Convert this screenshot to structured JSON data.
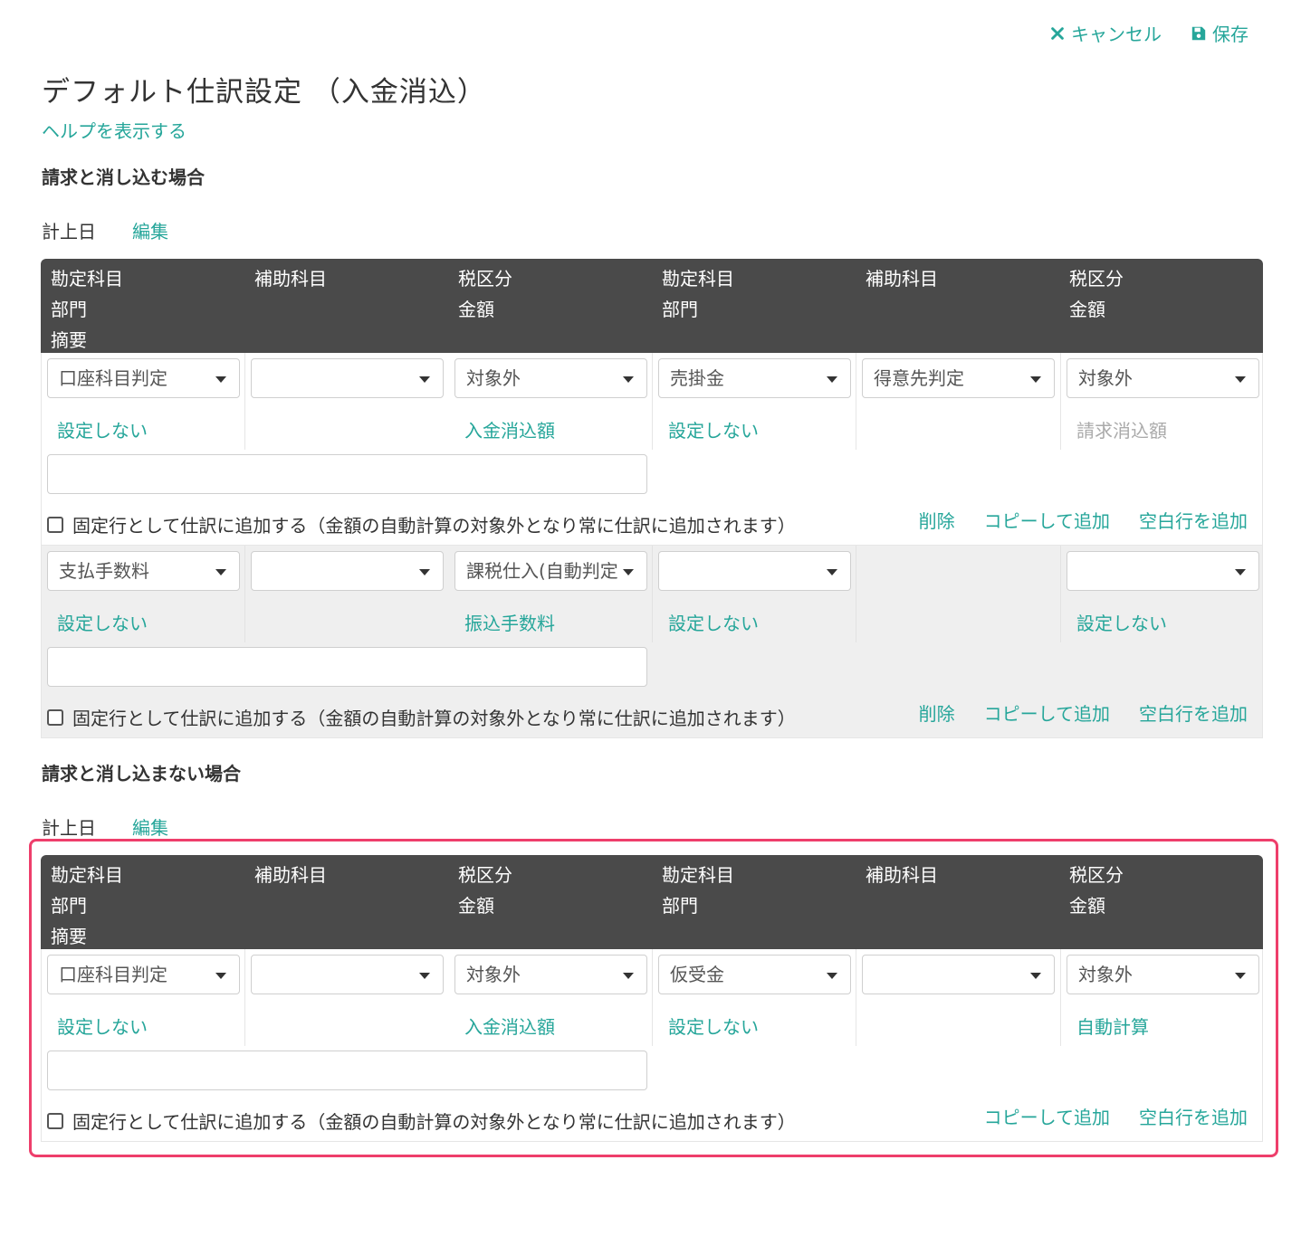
{
  "header": {
    "cancel_label": "キャンセル",
    "save_label": "保存",
    "title": "デフォルト仕訳設定 （入金消込）",
    "help_label": "ヘルプを表示する"
  },
  "columns": {
    "account": "勘定科目",
    "sub_account": "補助科目",
    "tax": "税区分",
    "department": "部門",
    "amount": "金額",
    "memo": "摘要"
  },
  "fixed_row_label": "固定行として仕訳に追加する（金額の自動計算の対象外となり常に仕訳に追加されます）",
  "action_labels": {
    "delete": "削除",
    "copy_add": "コピーして追加",
    "blank_add": "空白行を追加"
  },
  "sections": [
    {
      "title": "請求と消し込む場合",
      "date_label": "計上日",
      "edit_label": "編集",
      "rows": [
        {
          "debit_account": "口座科目判定",
          "debit_sub": "",
          "debit_tax": "対象外",
          "credit_account": "売掛金",
          "credit_sub": "得意先判定",
          "credit_tax": "対象外",
          "debit_dept": "設定しない",
          "debit_amount": "入金消込額",
          "credit_dept": "設定しない",
          "credit_amount": "請求消込額"
        },
        {
          "debit_account": "支払手数料",
          "debit_sub": "",
          "debit_tax": "課税仕入(自動判定",
          "credit_account": "",
          "credit_sub": "",
          "credit_tax": "",
          "debit_dept": "設定しない",
          "debit_amount": "振込手数料",
          "credit_dept": "設定しない",
          "credit_amount": "設定しない"
        }
      ]
    },
    {
      "title": "請求と消し込まない場合",
      "date_label": "計上日",
      "edit_label": "編集",
      "rows": [
        {
          "debit_account": "口座科目判定",
          "debit_sub": "",
          "debit_tax": "対象外",
          "credit_account": "仮受金",
          "credit_sub": "",
          "credit_tax": "対象外",
          "debit_dept": "設定しない",
          "debit_amount": "入金消込額",
          "credit_dept": "設定しない",
          "credit_amount": "自動計算"
        }
      ]
    }
  ],
  "colors": {
    "accent": "#26a69a",
    "header_bg": "#4a4a4a",
    "highlight": "#ee3e6b"
  }
}
